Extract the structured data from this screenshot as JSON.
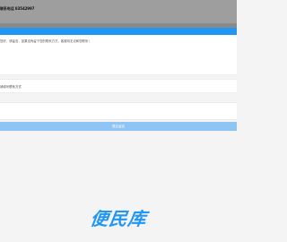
{
  "header": {
    "phone_text": "联系电话 83542997"
  },
  "message": {
    "placeholder": "您好，请留言，如果没有留下您的联系方式，客服将无法和您联系！"
  },
  "contact": {
    "placeholder": "请填写联系方式"
  },
  "submit": {
    "label": "提交留言"
  },
  "logo": {
    "text": "便民库"
  },
  "colors": {
    "accent": "#2196f3",
    "button": "#8ec5f5",
    "header_gray": "#9e9e9e"
  }
}
